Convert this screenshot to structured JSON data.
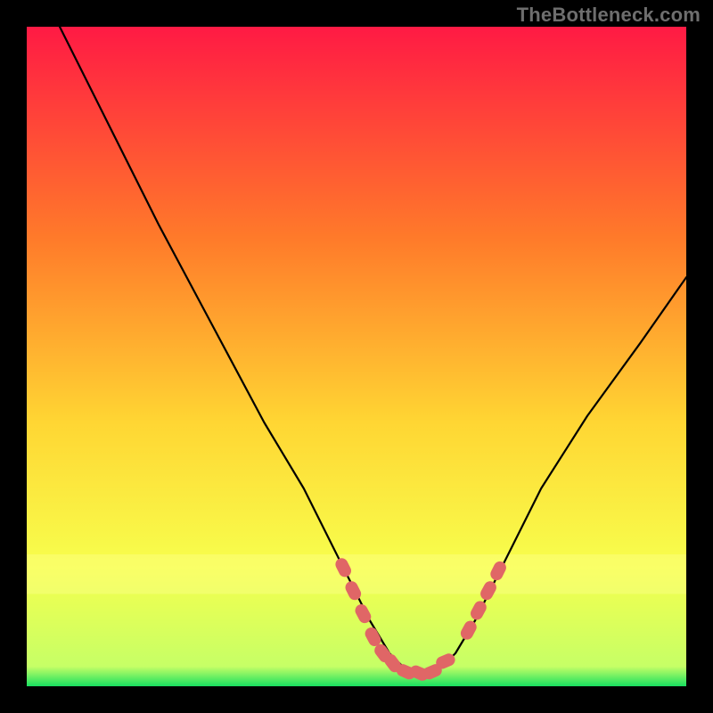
{
  "watermark": "TheBottleneck.com",
  "colors": {
    "frame_bg": "#000000",
    "gradient_top": "#ff1a44",
    "gradient_mid1": "#ff7a2a",
    "gradient_mid2": "#ffd633",
    "gradient_mid3": "#f7ff4d",
    "gradient_bottom": "#18e060",
    "curve": "#000000",
    "marker": "#e06666"
  },
  "chart_data": {
    "type": "line",
    "title": "",
    "xlabel": "",
    "ylabel": "",
    "xlim": [
      0,
      100
    ],
    "ylim": [
      0,
      100
    ],
    "series": [
      {
        "name": "bottleneck_curve",
        "x": [
          5,
          12,
          20,
          28,
          36,
          42,
          48,
          52,
          55,
          58,
          62,
          65,
          68,
          72,
          78,
          85,
          93,
          100
        ],
        "y": [
          100,
          86,
          70,
          55,
          40,
          30,
          18,
          10,
          5,
          2,
          2,
          5,
          10,
          18,
          30,
          41,
          52,
          62
        ]
      }
    ],
    "markers": [
      {
        "x": 48,
        "y": 18
      },
      {
        "x": 49.5,
        "y": 14.5
      },
      {
        "x": 51,
        "y": 11
      },
      {
        "x": 52.5,
        "y": 7.5
      },
      {
        "x": 54,
        "y": 5
      },
      {
        "x": 55.5,
        "y": 3.5
      },
      {
        "x": 57.5,
        "y": 2.2
      },
      {
        "x": 59.5,
        "y": 2
      },
      {
        "x": 61.5,
        "y": 2.2
      },
      {
        "x": 63.5,
        "y": 3.8
      },
      {
        "x": 67,
        "y": 8.5
      },
      {
        "x": 68.5,
        "y": 11.5
      },
      {
        "x": 70,
        "y": 14.5
      },
      {
        "x": 71.5,
        "y": 17.5
      }
    ]
  }
}
